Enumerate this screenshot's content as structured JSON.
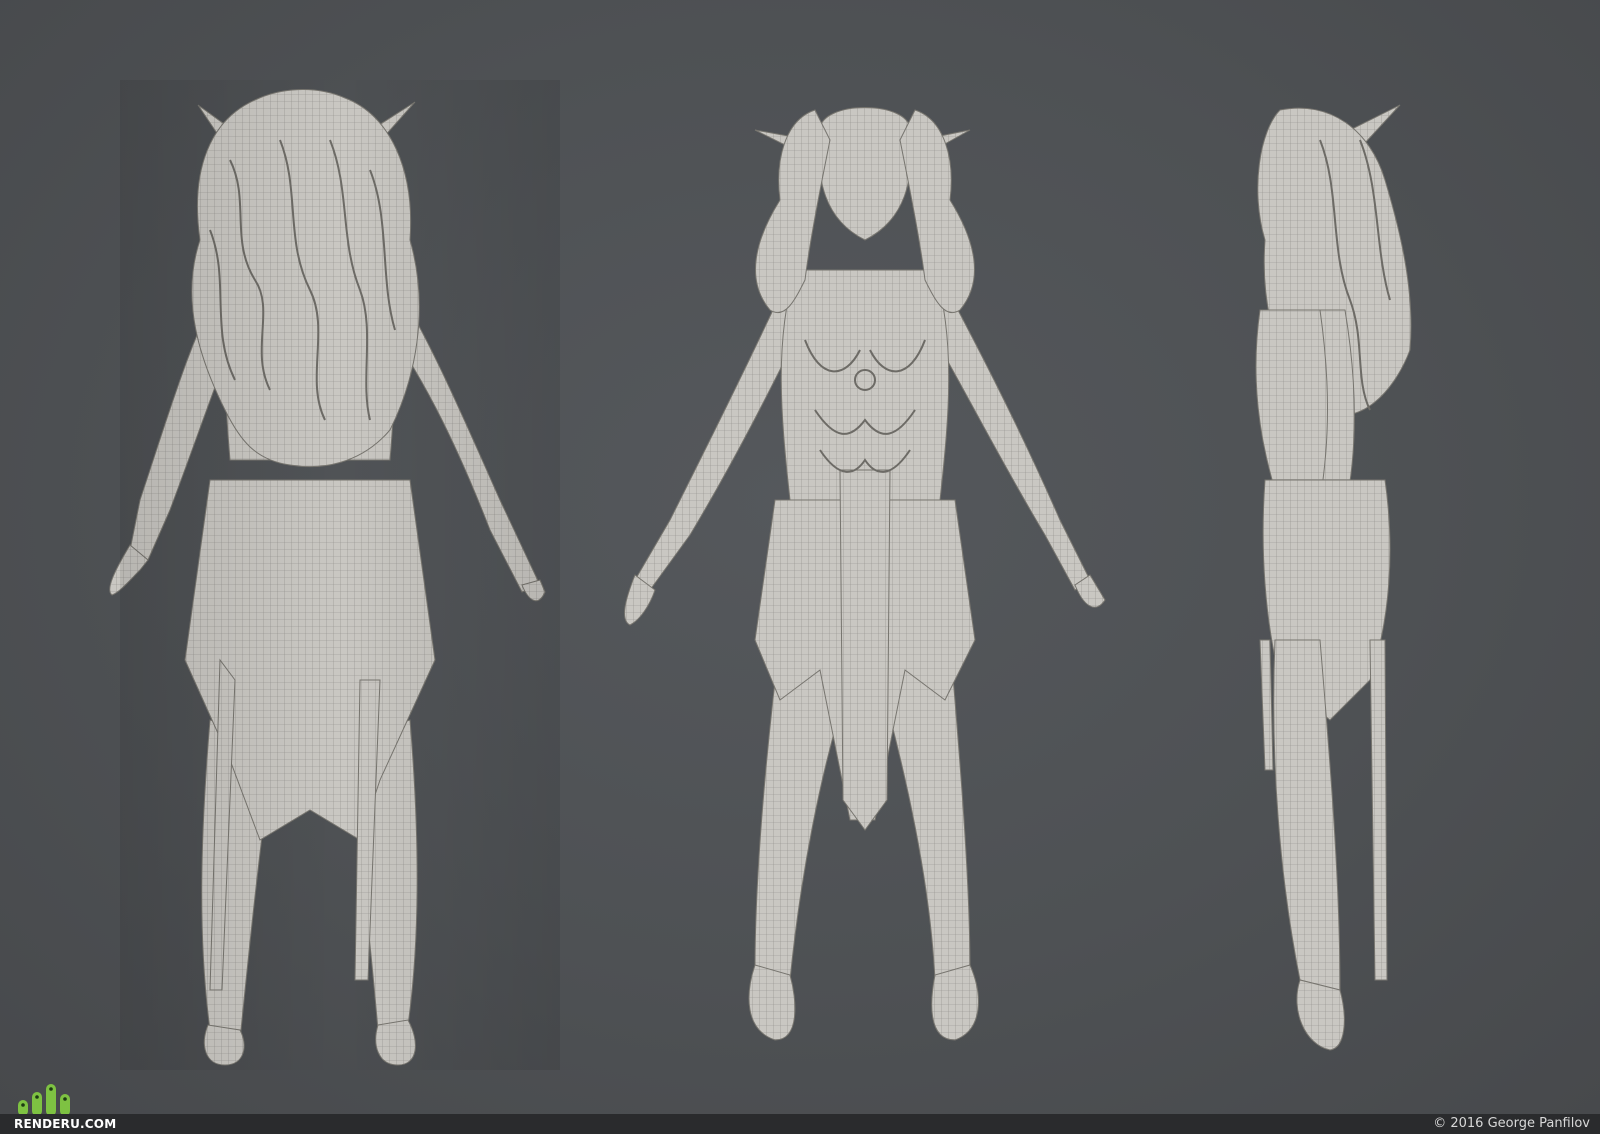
{
  "scene": {
    "background": "#4e5154",
    "model_color": "#c9c7c2",
    "wire_color": "#8e8c88",
    "views": [
      {
        "view": "back"
      },
      {
        "view": "front"
      },
      {
        "view": "side"
      }
    ]
  },
  "watermark": {
    "logo_text": "RENDERU.COM",
    "logo_accent": "#7ec242",
    "icon": "renderu-logo-icon"
  },
  "footer": {
    "copyright": "© 2016 George Panfilov",
    "bar_color": "#2a2b2d"
  }
}
